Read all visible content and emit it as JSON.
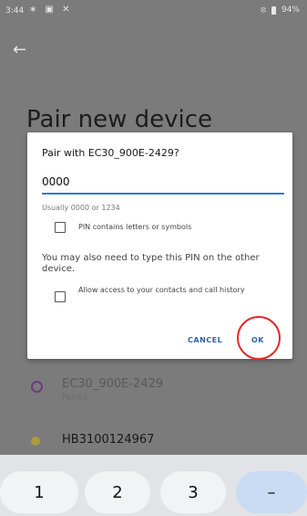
{
  "status_bar": {
    "time": "3:44",
    "left_icons": "∗ ▣ ✕",
    "right_icon": "⦻",
    "battery": "94%"
  },
  "page": {
    "title": "Pair new device",
    "back_icon": "arrow-left-icon"
  },
  "devices": [
    {
      "name": "EC30_900E-2429",
      "status": "Paired",
      "icon": "headset-icon"
    },
    {
      "name": "HB3100124967",
      "status": "",
      "icon": "device-dot-icon"
    }
  ],
  "dialog": {
    "title": "Pair with EC30_900E-2429?",
    "pin_value": "0000",
    "pin_hint": "Usually 0000 or 1234",
    "pin_letters_label": "PIN contains letters or symbols",
    "info": "You may also need to type this PIN on the other device.",
    "allow_access_label": "Allow access to your contacts and call history",
    "cancel_label": "CANCEL",
    "ok_label": "OK"
  },
  "keyboard": {
    "keys": [
      "1",
      "2",
      "3",
      "–"
    ]
  },
  "colors": {
    "accent": "#2f7bd0",
    "highlight": "#e02a2a"
  }
}
